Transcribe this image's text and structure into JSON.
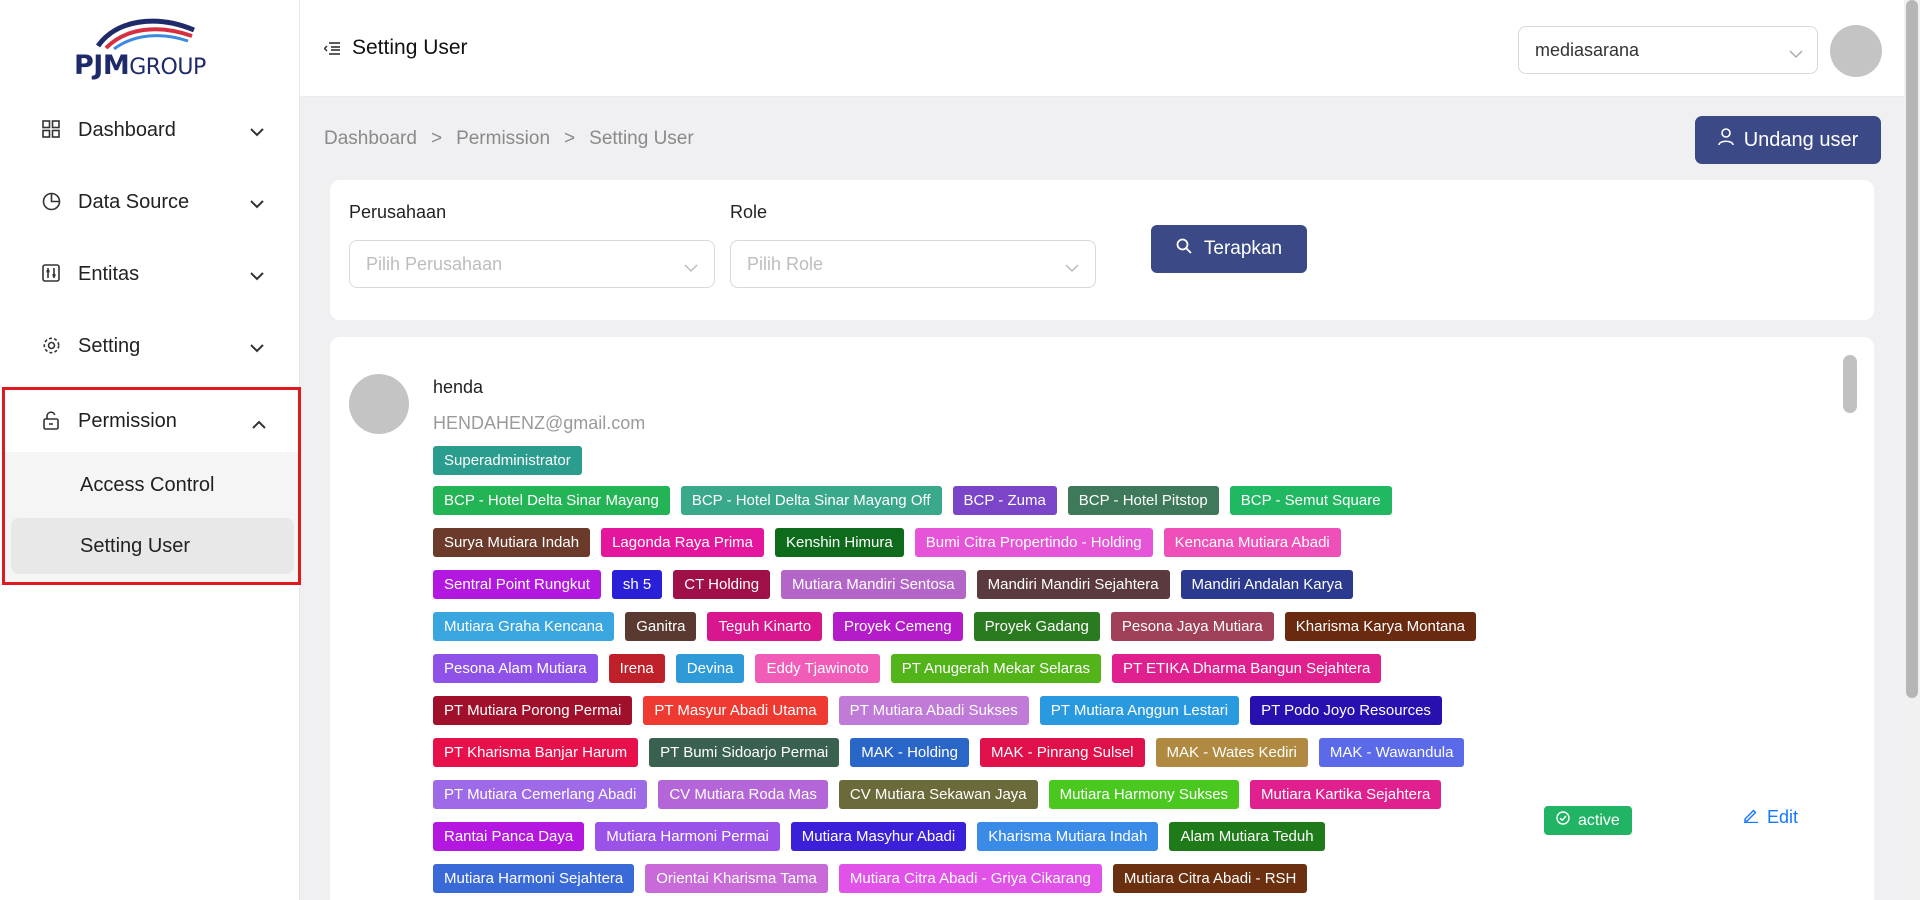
{
  "logo": {
    "main": "PJM",
    "sub": "GROUP"
  },
  "sidebar": {
    "items": [
      {
        "label": "Dashboard",
        "icon": "grid-icon"
      },
      {
        "label": "Data Source",
        "icon": "pie-chart-icon"
      },
      {
        "label": "Entitas",
        "icon": "sliders-icon"
      },
      {
        "label": "Setting",
        "icon": "gear-icon"
      }
    ],
    "permission": {
      "label": "Permission",
      "icon": "lock-icon",
      "children": [
        {
          "label": "Access Control"
        },
        {
          "label": "Setting User",
          "active": true
        }
      ]
    }
  },
  "header": {
    "title": "Setting User",
    "company_selected": "mediasarana"
  },
  "breadcrumb": {
    "items": [
      "Dashboard",
      ">",
      "Permission",
      ">",
      "Setting User"
    ]
  },
  "invite_button": {
    "label": "Undang user"
  },
  "filter": {
    "company_label": "Perusahaan",
    "company_placeholder": "Pilih Perusahaan",
    "role_label": "Role",
    "role_placeholder": "Pilih Role",
    "apply_label": "Terapkan"
  },
  "user": {
    "name": "henda",
    "email": "HENDAHENZ@gmail.com",
    "role": "Superadministrator",
    "status": "active",
    "edit_label": "Edit",
    "companies": [
      [
        {
          "name": "BCP - Hotel Delta Sinar Mayang",
          "color": "#22b455"
        },
        {
          "name": "BCP - Hotel Delta Sinar Mayang Off",
          "color": "#3aa88a"
        },
        {
          "name": "BCP - Zuma",
          "color": "#7b45c9"
        },
        {
          "name": "BCP - Hotel Pitstop",
          "color": "#3e7a5a"
        },
        {
          "name": "BCP - Semut Square",
          "color": "#20b860"
        }
      ],
      [
        {
          "name": "Surya Mutiara Indah",
          "color": "#6b3a2a"
        },
        {
          "name": "Lagonda Raya Prima",
          "color": "#e5169e"
        },
        {
          "name": "Kenshin Himura",
          "color": "#0f6b1c"
        },
        {
          "name": "Bumi Citra Propertindo - Holding",
          "color": "#e655d8"
        },
        {
          "name": "Kencana Mutiara Abadi",
          "color": "#ee4fb8"
        }
      ],
      [
        {
          "name": "Sentral Point Rungkut",
          "color": "#b318e0"
        },
        {
          "name": "sh 5",
          "color": "#2a20d8"
        },
        {
          "name": "CT Holding",
          "color": "#a01048"
        },
        {
          "name": "Mutiara Mandiri Sentosa",
          "color": "#b466c8"
        },
        {
          "name": "Mandiri Mandiri Sejahtera",
          "color": "#5a3a3e"
        },
        {
          "name": "Mandiri Andalan Karya",
          "color": "#2b3a8e"
        }
      ],
      [
        {
          "name": "Mutiara Graha Kencana",
          "color": "#3aa6e0"
        },
        {
          "name": "Ganitra",
          "color": "#5a3a30"
        },
        {
          "name": "Teguh Kinarto",
          "color": "#d8168e"
        },
        {
          "name": "Proyek Cemeng",
          "color": "#b31cc8"
        },
        {
          "name": "Proyek Gadang",
          "color": "#2a7a20"
        },
        {
          "name": "Pesona Jaya Mutiara",
          "color": "#a04058"
        },
        {
          "name": "Kharisma Karya Montana",
          "color": "#6a2a10"
        }
      ],
      [
        {
          "name": "Pesona Alam Mutiara",
          "color": "#8e52e8"
        },
        {
          "name": "Irena",
          "color": "#c0202a"
        },
        {
          "name": "Devina",
          "color": "#2e9ad8"
        },
        {
          "name": "Eddy Tjawinoto",
          "color": "#f05cb8"
        },
        {
          "name": "PT Anugerah Mekar Selaras",
          "color": "#52b418"
        },
        {
          "name": "PT ETIKA Dharma Bangun Sejahtera",
          "color": "#e0208e"
        }
      ],
      [
        {
          "name": "PT Mutiara Porong Permai",
          "color": "#a0102a"
        },
        {
          "name": "PT Masyur Abadi Utama",
          "color": "#ee3a30"
        },
        {
          "name": "PT Mutiara Abadi Sukses",
          "color": "#c07ad8"
        },
        {
          "name": "PT Mutiara Anggun Lestari",
          "color": "#2a9ae0"
        },
        {
          "name": "PT Podo Joyo Resources",
          "color": "#2610b0"
        }
      ],
      [
        {
          "name": "PT Kharisma Banjar Harum",
          "color": "#e8104a"
        },
        {
          "name": "PT Bumi Sidoarjo Permai",
          "color": "#3a6050"
        },
        {
          "name": "MAK - Holding",
          "color": "#2a66c8"
        },
        {
          "name": "MAK - Pinrang Sulsel",
          "color": "#e0104a"
        },
        {
          "name": "MAK - Wates Kediri",
          "color": "#b08a40"
        },
        {
          "name": "MAK - Wawandula",
          "color": "#5a6ae8"
        }
      ],
      [
        {
          "name": "PT Mutiara Cemerlang Abadi",
          "color": "#9e6ae8"
        },
        {
          "name": "CV Mutiara Roda Mas",
          "color": "#b466d8"
        },
        {
          "name": "CV Mutiara Sekawan Jaya",
          "color": "#6a6a3a"
        },
        {
          "name": "Mutiara Harmony Sukses",
          "color": "#4ac820"
        },
        {
          "name": "Mutiara Kartika Sejahtera",
          "color": "#e0208e"
        }
      ],
      [
        {
          "name": "Rantai Panca Daya",
          "color": "#b418e0"
        },
        {
          "name": "Mutiara Harmoni Permai",
          "color": "#9a52e8"
        },
        {
          "name": "Mutiara Masyhur Abadi",
          "color": "#3a20d8"
        },
        {
          "name": "Kharisma Mutiara Indah",
          "color": "#3a8ae8"
        },
        {
          "name": "Alam Mutiara Teduh",
          "color": "#1f7a1a"
        }
      ],
      [
        {
          "name": "Mutiara Harmoni Sejahtera",
          "color": "#3a6ad8"
        },
        {
          "name": "Orientai Kharisma Tama",
          "color": "#c86ad8"
        },
        {
          "name": "Mutiara Citra Abadi - Griya Cikarang",
          "color": "#e052e8"
        },
        {
          "name": "Mutiara Citra Abadi - RSH",
          "color": "#6a3010"
        }
      ]
    ]
  },
  "colors": {
    "primary": "#3b4a86",
    "highlight_border": "#e0191f",
    "active_status": "#21b465",
    "edit_link": "#1677ff"
  }
}
